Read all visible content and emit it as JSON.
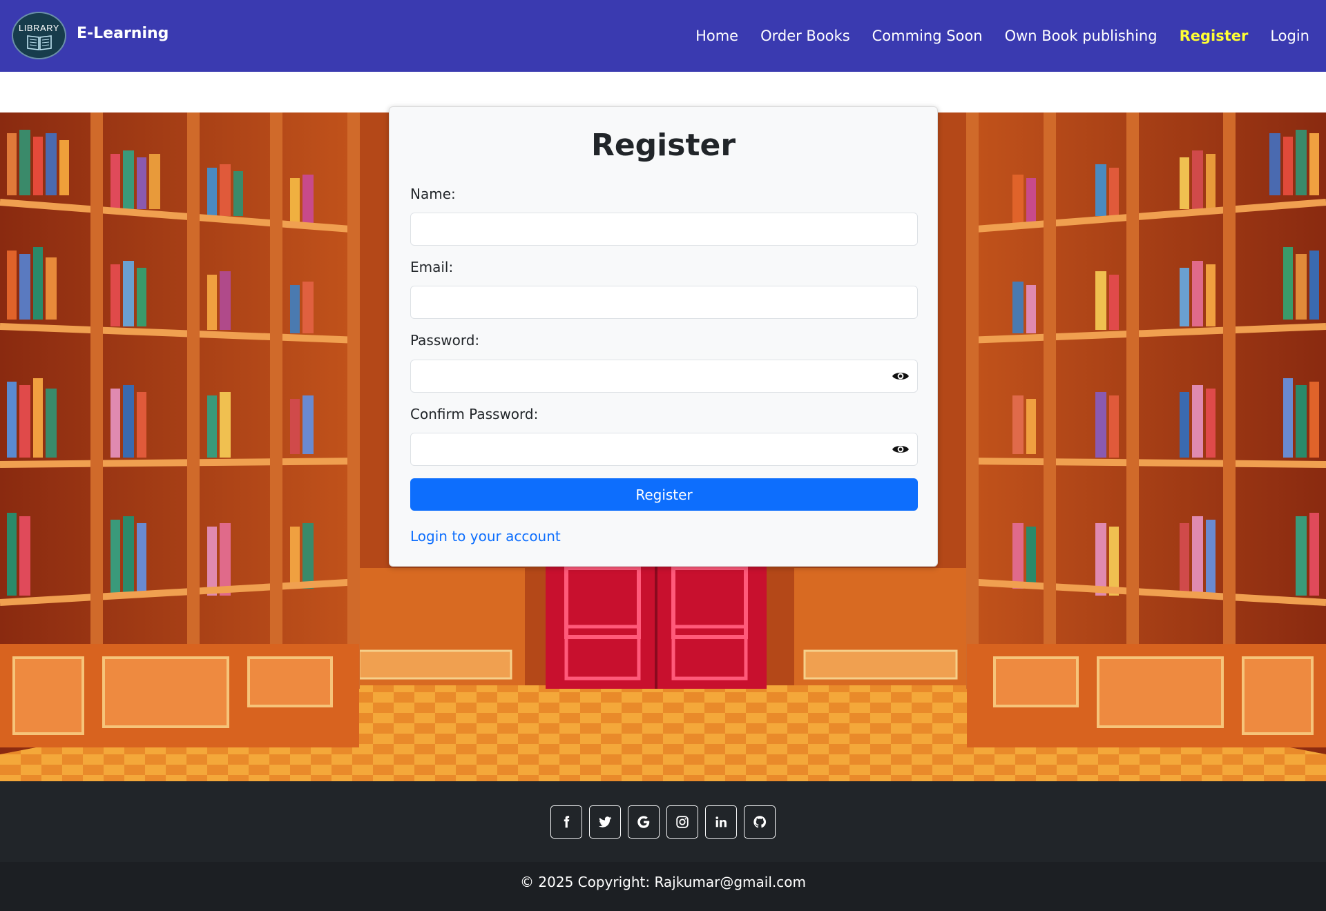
{
  "brand": {
    "logo_text": "LIBRARY",
    "name": "E-Learning"
  },
  "nav": {
    "items": [
      {
        "label": "Home"
      },
      {
        "label": "Order Books"
      },
      {
        "label": "Comming Soon"
      },
      {
        "label": "Own Book publishing"
      },
      {
        "label": "Register",
        "active": true
      },
      {
        "label": "Login"
      }
    ]
  },
  "form": {
    "title": "Register",
    "name_label": "Name:",
    "name_value": "",
    "email_label": "Email:",
    "email_value": "",
    "password_label": "Password:",
    "password_value": "",
    "confirm_label": "Confirm Password:",
    "confirm_value": "",
    "submit_label": "Register",
    "login_link": "Login to your account"
  },
  "footer": {
    "social_icons": [
      "facebook-icon",
      "twitter-icon",
      "google-icon",
      "instagram-icon",
      "linkedin-icon",
      "github-icon"
    ],
    "copyright": "© 2025 Copyright: Rajkumar@gmail.com"
  },
  "colors": {
    "navbar": "#3a3ab0",
    "active_nav": "#ffff33",
    "primary": "#0d6efd",
    "footer": "#212529"
  }
}
